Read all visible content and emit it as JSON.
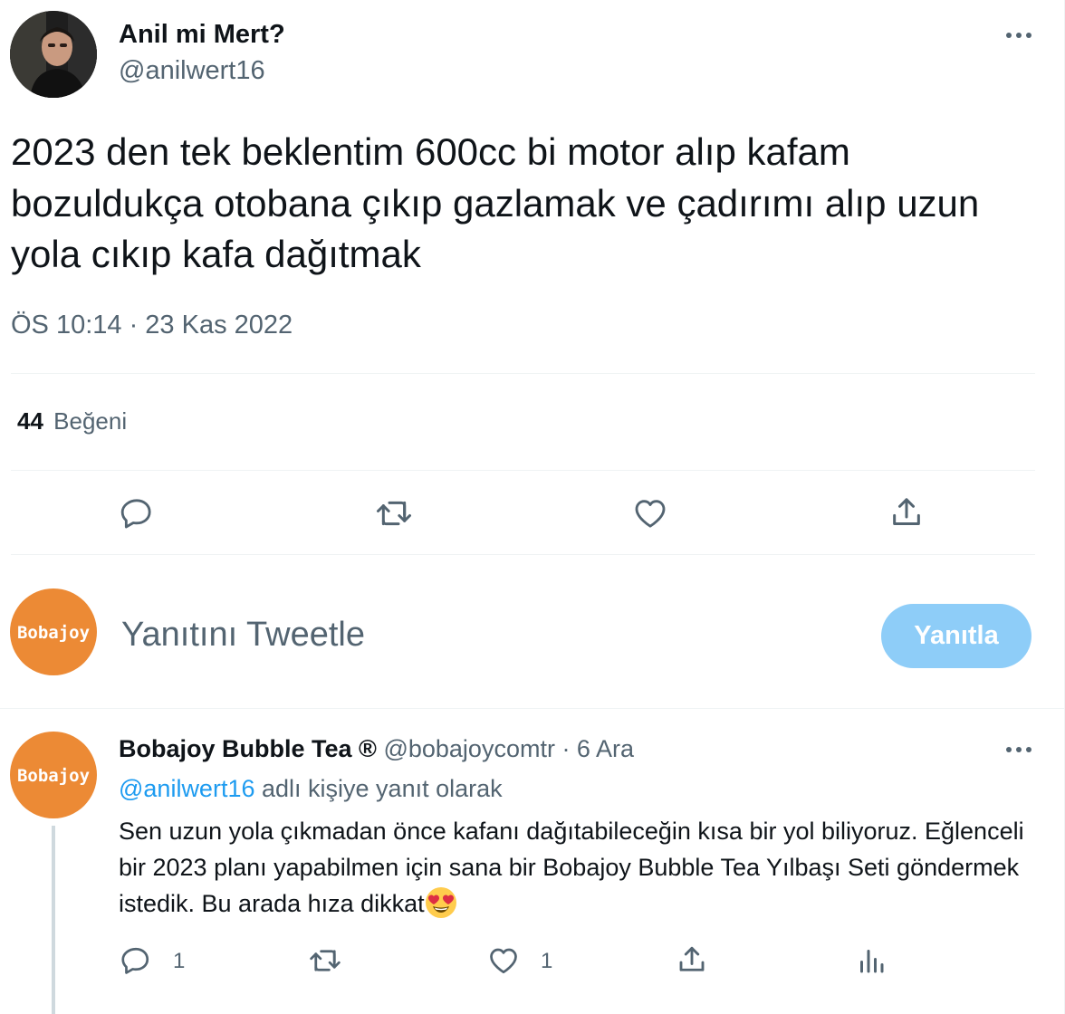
{
  "tweet": {
    "author_name": "Anil mi Mert?",
    "author_handle": "@anilwert16",
    "text": "2023 den tek beklentim 600cc bi motor alıp kafam bozuldukça otobana çıkıp gazlamak ve çadırımı alıp uzun yola cıkıp kafa dağıtmak",
    "timestamp": "ÖS 10:14 · 23 Kas 2022",
    "likes_count": "44",
    "likes_label": "Beğeni",
    "icons": [
      "more-icon",
      "reply-icon",
      "retweet-icon",
      "like-icon",
      "share-icon"
    ]
  },
  "composer": {
    "avatar_text": "Bobajoy",
    "placeholder": "Yanıtını Tweetle",
    "button_label": "Yanıtla"
  },
  "reply": {
    "author_name": "Bobajoy Bubble Tea ®",
    "meta": "@bobajoycomtr · 6 Ara",
    "avatar_text": "Bobajoy",
    "replying_to_mention": "@anilwert16",
    "replying_to_label": "adlı kişiye yanıt olarak",
    "text": "Sen uzun yola çıkmadan önce kafanı dağıtabileceğin kısa bir yol biliyoruz. Eğlenceli bir 2023 planı yapabilmen için sana bir Bobajoy Bubble Tea Yılbaşı Seti göndermek istedik. Bu arada hıza dikkat",
    "emoji": "smiling-face-with-heart-eyes",
    "reply_count": "1",
    "like_count": "1",
    "icons": [
      "reply-icon",
      "retweet-icon",
      "like-icon",
      "share-icon",
      "analytics-icon"
    ]
  },
  "colors": {
    "primary_text": "#0f1419",
    "secondary_text": "#536471",
    "link": "#1d9bf0",
    "button_disabled": "#8ecdf8",
    "brand_orange": "#ec8a35",
    "divider": "#eff3f4"
  }
}
